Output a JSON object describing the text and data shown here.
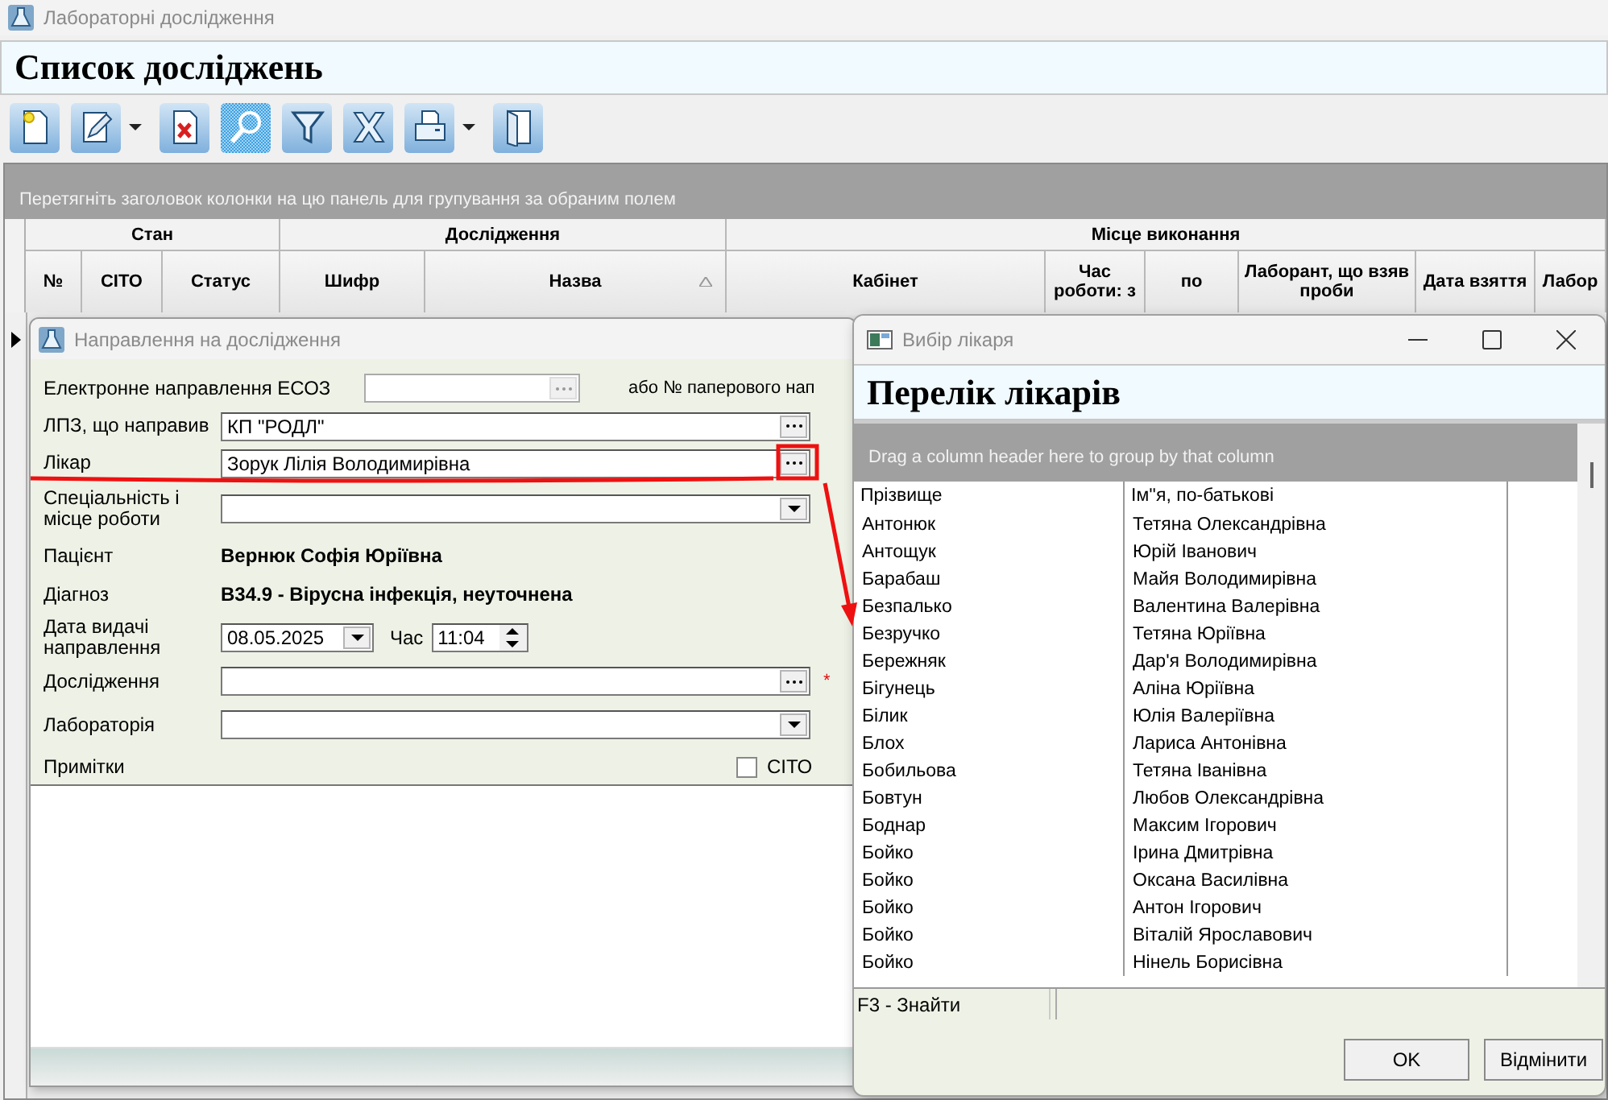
{
  "main_window": {
    "title": "Лабораторні дослідження",
    "heading": "Список досліджень",
    "toolbar": [
      {
        "kind": "new",
        "dropdown": false,
        "pressed": false
      },
      {
        "kind": "edit",
        "dropdown": true,
        "pressed": false
      },
      {
        "kind": "delete",
        "dropdown": false,
        "pressed": false
      },
      {
        "kind": "search",
        "dropdown": false,
        "pressed": true
      },
      {
        "kind": "filter",
        "dropdown": false,
        "pressed": false
      },
      {
        "kind": "excel",
        "dropdown": false,
        "pressed": false
      },
      {
        "kind": "print",
        "dropdown": true,
        "pressed": false
      },
      {
        "kind": "exit",
        "dropdown": false,
        "pressed": false
      }
    ],
    "grid": {
      "group_panel": "Перетягніть заголовок колонки на цю панель для групування за обраним полем",
      "header_groups": [
        {
          "label": "Стан",
          "columns": [
            {
              "label": "№",
              "sorted": false
            },
            {
              "label": "СІТО",
              "sorted": false
            },
            {
              "label": "Статус",
              "sorted": false
            }
          ]
        },
        {
          "label": "Дослідження",
          "columns": [
            {
              "label": "Шифр",
              "sorted": false
            },
            {
              "label": "Назва",
              "sorted": true
            }
          ]
        },
        {
          "label": "Місце виконання",
          "columns": [
            {
              "label": "Кабінет",
              "sorted": false
            },
            {
              "label": "Час роботи: з",
              "sorted": false
            },
            {
              "label": "по",
              "sorted": false
            },
            {
              "label": "Лаборант, що взяв проби",
              "sorted": false
            },
            {
              "label": "Дата взяття",
              "sorted": false
            },
            {
              "label": "Лабор",
              "sorted": false
            }
          ]
        }
      ]
    }
  },
  "referral_dialog": {
    "title": "Направлення на дослідження",
    "fields": [
      {
        "kind": "short_lookup",
        "label": "Електронне направлення ЕСОЗ",
        "note": "або № паперового нап"
      },
      {
        "kind": "lookup",
        "label": "ЛПЗ, що направив",
        "value": "КП \"РОДЛ\""
      },
      {
        "kind": "lookup",
        "label": "Лікар",
        "value": "Зорук Лілія Володимирівна"
      },
      {
        "kind": "combo",
        "label": "Спеціальність і місце роботи"
      },
      {
        "kind": "static",
        "label": "Пацієнт",
        "value": "Вернюк Софія Юріївна"
      },
      {
        "kind": "static",
        "label": "Діагноз",
        "value": "B34.9 - Вірусна інфекція, неуточнена"
      },
      {
        "kind": "datetime",
        "label": "Дата видачі направлення",
        "value": "08.05.2025",
        "time_label": "Час",
        "time": "11:04"
      },
      {
        "kind": "lookup",
        "label": "Дослідження",
        "required_mark": "*"
      },
      {
        "kind": "combo",
        "label": "Лабораторія"
      }
    ],
    "notes": {
      "label": "Примітки"
    },
    "cito": {
      "label": "СІТО",
      "checked": false
    }
  },
  "doctor_dialog": {
    "title": "Вибір лікаря",
    "heading": "Перелік лікарів",
    "group_panel": "Drag a column header here to group by that column",
    "columns": [
      "Прізвище",
      "Ім''я, по-батькові"
    ],
    "rows": [
      [
        "Антонюк",
        "Тетяна Олександрівна"
      ],
      [
        "Антощук",
        "Юрій Іванович"
      ],
      [
        "Барабаш",
        "Майя Володимирівна"
      ],
      [
        "Безпалько",
        "Валентина Валерівна"
      ],
      [
        "Безручко",
        "Тетяна Юріївна"
      ],
      [
        "Бережняк",
        "Дар'я Володимирівна"
      ],
      [
        "Бігунець",
        "Аліна Юріївна"
      ],
      [
        "Білик",
        "Юлія Валеріївна"
      ],
      [
        "Блох",
        "Лариса Антонівна"
      ],
      [
        "Бобильова",
        "Тетяна Іванівна"
      ],
      [
        "Бовтун",
        "Любов Олександрівна"
      ],
      [
        "Боднар",
        "Максим Ігорович"
      ],
      [
        "Бойко",
        "Ірина Дмитрівна"
      ],
      [
        "Бойко",
        "Оксана Василівна"
      ],
      [
        "Бойко",
        "Антон Ігорович"
      ],
      [
        "Бойко",
        "Віталій Ярославович"
      ],
      [
        "Бойко",
        "Нінель Борисівна"
      ]
    ],
    "status_hint": "F3 - Знайти",
    "buttons": [
      "OK",
      "Відмінити"
    ]
  }
}
